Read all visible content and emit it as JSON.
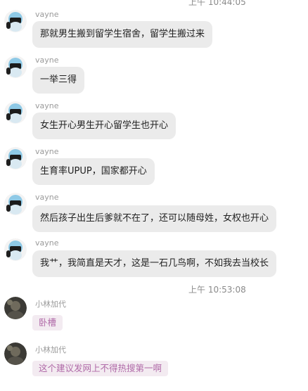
{
  "timestamps": {
    "top": "上午 10:44:05",
    "middle": "上午 10:53:08"
  },
  "messages": [
    {
      "sender": "vayne",
      "text": "那就男生搬到留学生宿舍，留学生搬过来"
    },
    {
      "sender": "vayne",
      "text": "一举三得"
    },
    {
      "sender": "vayne",
      "text": "女生开心男生开心留学生也开心"
    },
    {
      "sender": "vayne",
      "text": "生育率UPUP，国家都开心"
    },
    {
      "sender": "vayne",
      "text": "然后孩子出生后爹就不在了，还可以随母姓，女权也开心"
    },
    {
      "sender": "vayne",
      "text": "我艹，我简直是天才，这是一石几鸟啊，不如我去当校长"
    },
    {
      "sender": "小林加代",
      "text": "卧槽"
    },
    {
      "sender": "小林加代",
      "text": "这个建议发网上不得热搜第一啊"
    }
  ],
  "colors": {
    "bubble": "#ebebeb",
    "pink_bubble": "#f3ebf1",
    "pink_text": "#b06aa8"
  }
}
